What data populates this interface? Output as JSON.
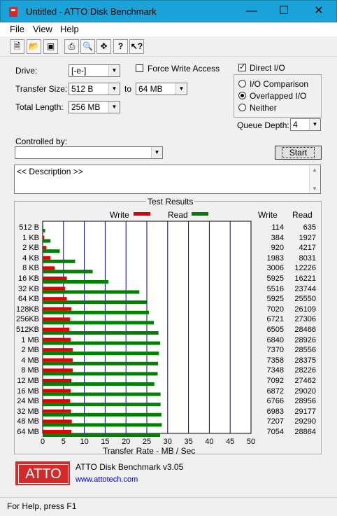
{
  "window": {
    "title": "Untitled - ATTO Disk Benchmark",
    "minimize": "—",
    "maximize": "☐",
    "close": "✕"
  },
  "menu": {
    "file": "File",
    "view": "View",
    "help": "Help"
  },
  "toolbar": {
    "icons": [
      "new-icon",
      "open-icon",
      "save-icon",
      "print-icon",
      "print-preview-icon",
      "move-icon",
      "help-icon",
      "context-help-icon"
    ]
  },
  "controls": {
    "drive_label": "Drive:",
    "drive_value": "[-e-]",
    "force_write_label": "Force Write Access",
    "force_write_checked": false,
    "direct_io_label": "Direct I/O",
    "direct_io_checked": true,
    "transfer_size_label": "Transfer Size:",
    "transfer_from": "512 B",
    "to_label": "to",
    "transfer_to": "64 MB",
    "total_length_label": "Total Length:",
    "total_length_value": "256 MB",
    "io_comparison_label": "I/O Comparison",
    "overlapped_io_label": "Overlapped I/O",
    "neither_label": "Neither",
    "selected_mode": "Overlapped I/O",
    "queue_depth_label": "Queue Depth:",
    "queue_depth_value": "4",
    "controlled_by_label": "Controlled by:",
    "controlled_by_value": "",
    "start_label": "Start",
    "description_text": "<< Description >>"
  },
  "results": {
    "title": "Test Results",
    "write_legend": "Write",
    "read_legend": "Read",
    "write_col": "Write",
    "read_col": "Read",
    "xlabel": "Transfer Rate - MB / Sec"
  },
  "chart_data": {
    "type": "bar",
    "xlabel": "Transfer Rate - MB / Sec",
    "xlim": [
      0,
      50
    ],
    "xticks": [
      "0",
      "5",
      "10",
      "15",
      "20",
      "25",
      "30",
      "35",
      "40",
      "45",
      "50"
    ],
    "categories": [
      "512 B",
      "1 KB",
      "2 KB",
      "4 KB",
      "8 KB",
      "16 KB",
      "32 KB",
      "64 KB",
      "128KB",
      "256KB",
      "512KB",
      "1 MB",
      "2 MB",
      "4 MB",
      "8 MB",
      "12 MB",
      "16 MB",
      "24 MB",
      "32 MB",
      "48 MB",
      "64 MB"
    ],
    "series": [
      {
        "name": "Write",
        "color": "#e00000",
        "values": [
          0.1,
          0.4,
          0.9,
          1.9,
          2.9,
          5.8,
          5.4,
          5.8,
          6.9,
          6.6,
          6.4,
          6.7,
          7.2,
          7.2,
          7.2,
          6.9,
          6.7,
          6.6,
          6.8,
          7.0,
          6.9
        ]
      },
      {
        "name": "Read",
        "color": "#008000",
        "values": [
          0.6,
          1.9,
          4.1,
          7.8,
          12.0,
          15.8,
          23.2,
          24.9,
          25.5,
          26.7,
          27.8,
          28.2,
          27.9,
          27.7,
          27.6,
          26.8,
          28.3,
          28.3,
          28.5,
          28.6,
          28.2
        ]
      }
    ],
    "write_text": [
      "114",
      "384",
      "920",
      "1983",
      "3006",
      "5925",
      "5516",
      "5925",
      "7020",
      "6721",
      "6505",
      "6840",
      "7370",
      "7358",
      "7348",
      "7092",
      "6872",
      "6766",
      "6983",
      "7207",
      "7054"
    ],
    "read_text": [
      "635",
      "1927",
      "4217",
      "8031",
      "12226",
      "16221",
      "23744",
      "25550",
      "26109",
      "27306",
      "28466",
      "28926",
      "28556",
      "28375",
      "28226",
      "27462",
      "29020",
      "28956",
      "29177",
      "29290",
      "28864"
    ],
    "grid": true,
    "legend": "top"
  },
  "footer": {
    "logo_text": "ATTO",
    "product": "ATTO Disk Benchmark v3.05",
    "url": "www.attotech.com"
  },
  "status": {
    "text": "For Help, press F1"
  },
  "colors": {
    "titlebar": "#1aa3d9",
    "write": "#e00000",
    "read": "#008000",
    "grid": "#00008b",
    "link": "#0000cc"
  }
}
